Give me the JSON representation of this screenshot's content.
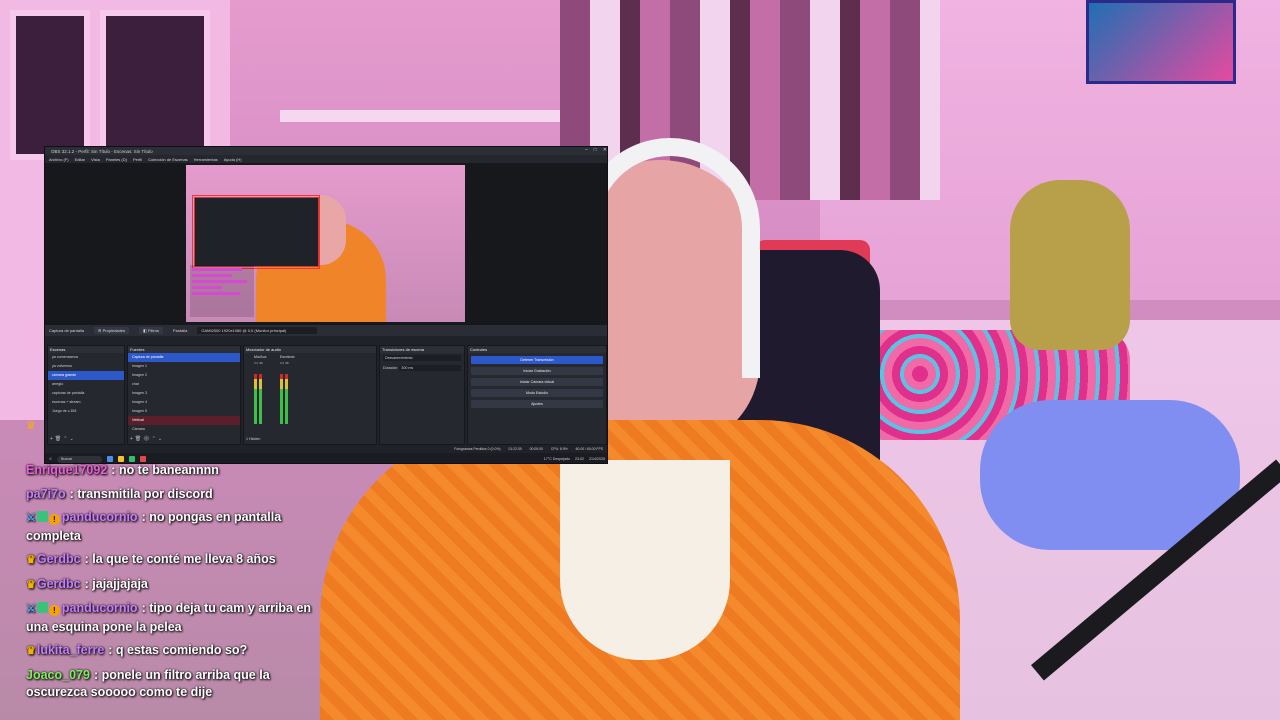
{
  "obs": {
    "window_title": "OBS 32.1.2 - Perfil: Sin Título - Escenas: Sin Título",
    "menu": [
      "Archivo (F)",
      "Editar",
      "Vista",
      "Paneles (D)",
      "Perfil",
      "Colección de Escenas",
      "Herramientas",
      "Ayuda (H)"
    ],
    "toolbar": {
      "source_label": "Captura de pantalla",
      "properties_label": "Propiedades",
      "filters_label": "Filtros",
      "screen_label": "Pantalla",
      "screen_value": "GAMI2000 1920x1080 @ 0,0 (Monitor principal)"
    },
    "scenes": {
      "title": "Escenas",
      "items": [
        "ya comenzamos",
        "ya volvemos",
        "cámara grande",
        "arreglo",
        "capturas de pantalla",
        "escenas + stream",
        "Juego de c-DM"
      ],
      "active_index": 2
    },
    "sources": {
      "title": "Fuentes",
      "items": [
        "Captura de pantalla",
        "Imagen 1",
        "Imagen 2",
        "chat",
        "Imagen 3",
        "Imagen 4",
        "Imagen 5",
        "Vertical",
        "Cámara"
      ],
      "active_index": 0,
      "alert_index": 7
    },
    "audio": {
      "title": "Mezclador de audio",
      "channels": [
        {
          "name": "Mic/Aux",
          "value": "0.0 dB"
        },
        {
          "name": "Escritorio",
          "value": "0.0 dB"
        },
        {
          "name": "Audio del escritorio",
          "value": "0.0 dB"
        }
      ],
      "footer": "1 Hidden"
    },
    "transitions": {
      "title": "Transiciones de escena",
      "type": "Desvanecimiento",
      "duration_label": "Duración",
      "duration_value": "300 ms"
    },
    "controls": {
      "title": "Controles",
      "buttons": [
        "Detener Transmisión",
        "Iniciar Grabación",
        "Iniciar Cámara virtual",
        "Modo Estudio",
        "Ajustes"
      ]
    },
    "status": {
      "dropped": "Fotogramas Perdidos 0 (0.0%)",
      "stream_time": "01:22:39",
      "rec": "00:00:00",
      "cpu": "CPU: 8.9%",
      "fps": "60.00 / 60.00 FPS"
    },
    "taskbar": {
      "search": "Buscar",
      "weather": "17°C Despejado",
      "time": "23:02",
      "date": "21/4/2025"
    }
  },
  "chat": {
    "messages": [
      {
        "user": "Enrique17092",
        "text": "no te baneannnn",
        "color": "#e85fd7",
        "badges": []
      },
      {
        "user": "pa7i7o",
        "text": "transmitila por discord",
        "color": "#c77dff",
        "badges": []
      },
      {
        "user": "panducornio",
        "text": "no pongas en pantalla completa",
        "color": "#c77dff",
        "badges": [
          "sword",
          "mod",
          "sub"
        ]
      },
      {
        "user": "Gerdbc",
        "text": "la que te conté me lleva 8 años",
        "color": "#c77dff",
        "badges": [
          "crown"
        ]
      },
      {
        "user": "Gerdbc",
        "text": "jajajjajaja",
        "color": "#c77dff",
        "badges": [
          "crown"
        ]
      },
      {
        "user": "panducornio",
        "text": "tipo deja tu cam y arriba en una esquina pone la pelea",
        "color": "#c77dff",
        "badges": [
          "sword",
          "mod",
          "sub"
        ]
      },
      {
        "user": "lukita_ferre",
        "text": "q estas comiendo so?",
        "color": "#c77dff",
        "badges": [
          "crown"
        ]
      },
      {
        "user": "Joaco_079",
        "text": "ponele un filtro arriba que la oscurezca sooooo como te dije",
        "color": "#7cf05a",
        "badges": []
      }
    ]
  },
  "colors": {
    "obs_bg": "#1f2228",
    "obs_active": "#2d58c9",
    "chat_text": "#ffffff",
    "crown": "#f5b300"
  }
}
